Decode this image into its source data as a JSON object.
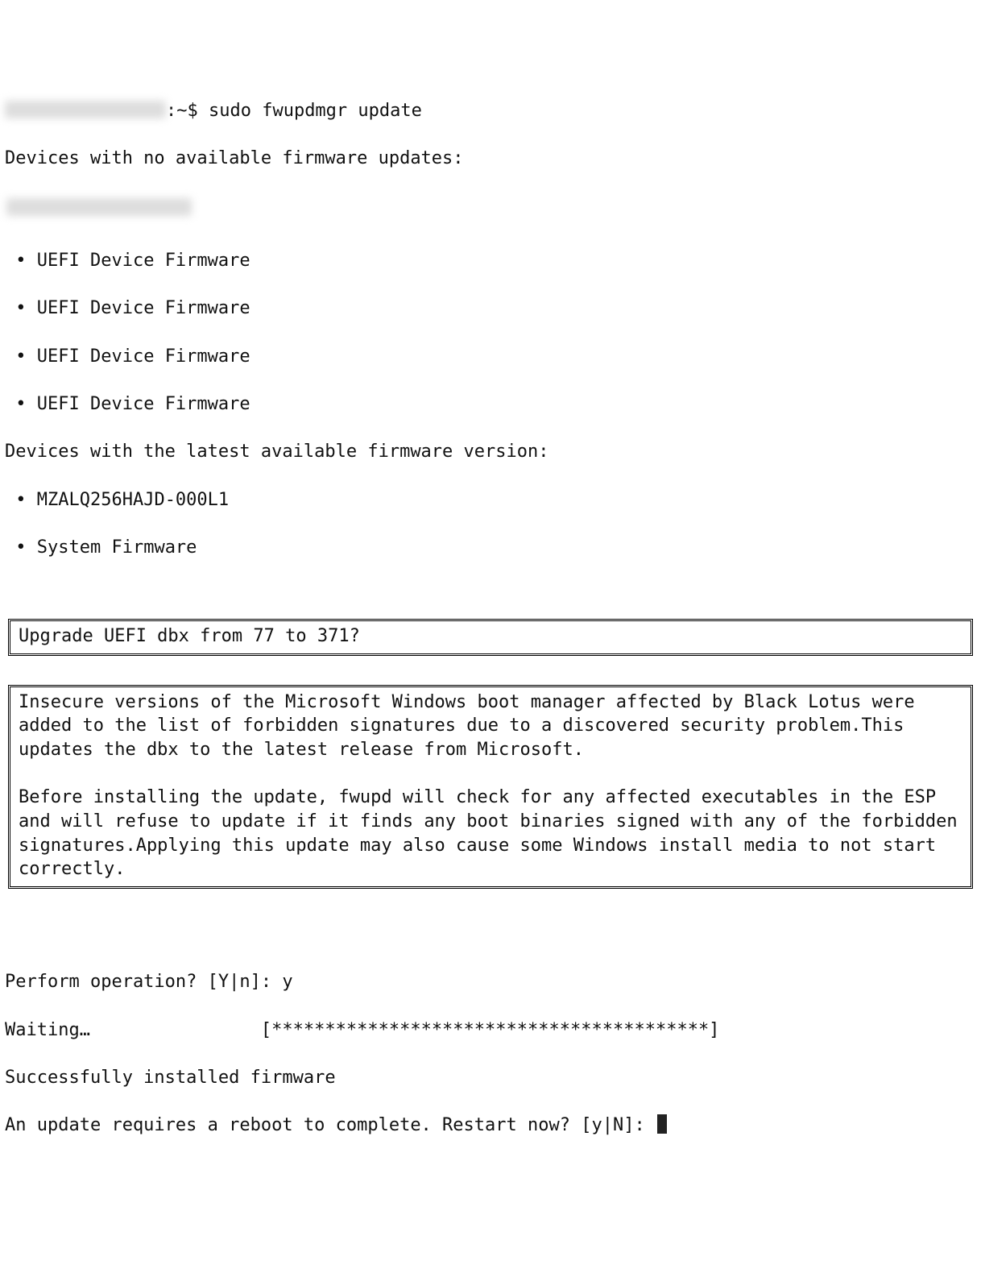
{
  "prompt": {
    "separator": ":~$ ",
    "command": "sudo fwupdmgr update"
  },
  "sections": {
    "no_updates_header": "Devices with no available firmware updates:",
    "no_updates_items": [
      "UEFI Device Firmware",
      "UEFI Device Firmware",
      "UEFI Device Firmware",
      "UEFI Device Firmware"
    ],
    "latest_header": "Devices with the latest available firmware version:",
    "latest_items": [
      "MZALQ256HAJD-000L1",
      "System Firmware"
    ]
  },
  "dialog": {
    "title": "Upgrade UEFI dbx from 77 to 371?",
    "body_p1": "Insecure versions of the Microsoft Windows boot manager affected by Black Lotus were added to the list of forbidden signatures due to a discovered security problem.This updates the dbx to the latest release from Microsoft.",
    "body_p2": "Before installing the update, fwupd will check for any affected executables in the ESP and will refuse to update if it finds any boot binaries signed with any of the forbidden signatures.Applying this update may also cause some Windows install media to not start correctly."
  },
  "footer": {
    "perform_prompt": "Perform operation? [Y|n]: ",
    "perform_answer": "y",
    "waiting_label": "Waiting…",
    "progress_bar": "[*****************************************]",
    "success": "Successfully installed firmware",
    "reboot_prompt": "An update requires a reboot to complete. Restart now? [y|N]: "
  }
}
